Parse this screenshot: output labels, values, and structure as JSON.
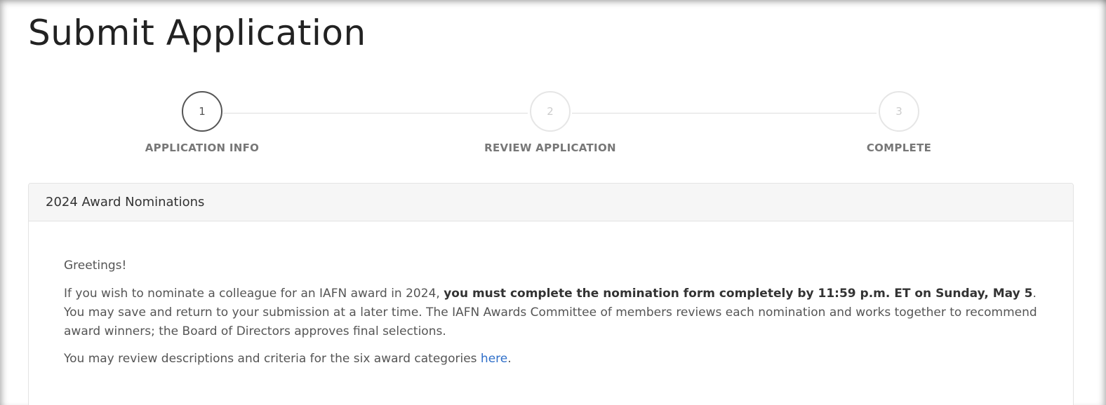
{
  "page": {
    "title": "Submit Application"
  },
  "stepper": {
    "steps": [
      {
        "number": "1",
        "label": "APPLICATION INFO",
        "active": true
      },
      {
        "number": "2",
        "label": "REVIEW APPLICATION",
        "active": false
      },
      {
        "number": "3",
        "label": "COMPLETE",
        "active": false
      }
    ]
  },
  "panel": {
    "heading": "2024 Award Nominations",
    "greeting": "Greetings!",
    "para1": {
      "before": "If you wish to nominate a colleague for an IAFN award in 2024, ",
      "bold": "you must complete the nomination form completely by 11:59 p.m. ET on Sunday, May 5",
      "after": ". You may save and return to your submission at a later time. The IAFN Awards Committee of members reviews each nomination and works together to recommend award winners; the Board of Directors approves final selections."
    },
    "para2": {
      "before": "You may review descriptions and criteria for the six award categories ",
      "link": "here",
      "after": "."
    }
  },
  "colors": {
    "link": "#2f6fc9",
    "active_step": "#555555",
    "inactive_step": "#cccccc"
  }
}
